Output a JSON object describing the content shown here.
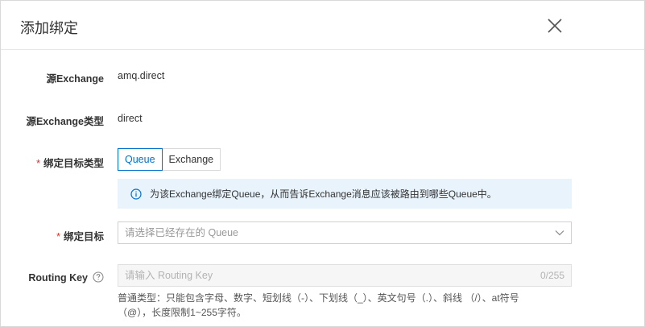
{
  "dialog": {
    "title": "添加绑定",
    "close_icon": "close-icon"
  },
  "form": {
    "source_exchange": {
      "label": "源Exchange",
      "value": "amq.direct"
    },
    "source_exchange_type": {
      "label": "源Exchange类型",
      "value": "direct"
    },
    "bind_target_type": {
      "required_mark": "*",
      "label": "绑定目标类型",
      "options": [
        "Queue",
        "Exchange"
      ],
      "selected": "Queue",
      "info_text": "为该Exchange绑定Queue，从而告诉Exchange消息应该被路由到哪些Queue中。",
      "info_icon": "info-icon"
    },
    "bind_target": {
      "required_mark": "*",
      "label": "绑定目标",
      "placeholder": "请选择已经存在的 Queue",
      "chevron_icon": "chevron-down-icon"
    },
    "routing_key": {
      "label": "Routing Key",
      "help_icon": "question-circle-icon",
      "placeholder": "请输入 Routing Key",
      "counter": "0/255",
      "hint": "普通类型：只能包含字母、数字、短划线（-）、下划线（_）、英文句号（.）、斜线 （/）、at符号（@），长度限制1~255字符。"
    }
  },
  "colors": {
    "accent": "#0070cc",
    "required": "#d93026",
    "info_bg": "#e8f3fc"
  }
}
